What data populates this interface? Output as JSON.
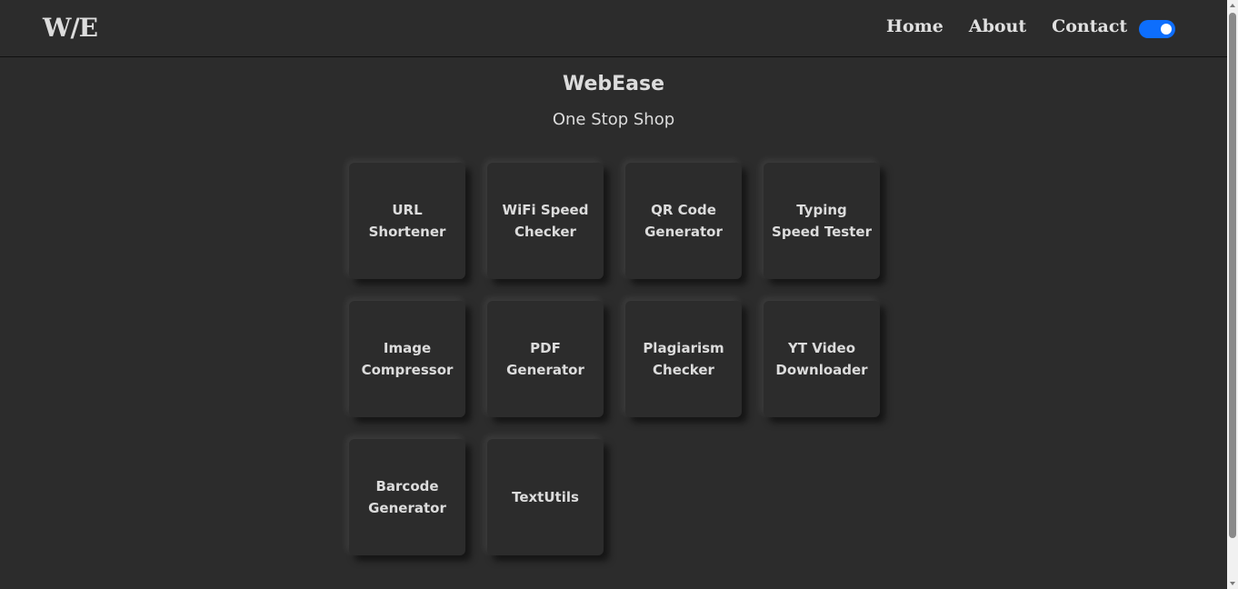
{
  "navbar": {
    "brand": "W/E",
    "links": [
      "Home",
      "About",
      "Contact"
    ],
    "dark_mode_toggle": {
      "on": true,
      "color": "#0d6efd"
    }
  },
  "hero": {
    "title": "WebEase",
    "subtitle": "One Stop Shop"
  },
  "tools": [
    "URL Shortener",
    "WiFi Speed Checker",
    "QR Code Generator",
    "Typing Speed Tester",
    "Image Compressor",
    "PDF Generator",
    "Plagiarism Checker",
    "YT Video Downloader",
    "Barcode Generator",
    "TextUtils"
  ],
  "colors": {
    "background": "#2c2c2c",
    "text": "#dcdcdc",
    "accent": "#0d6efd"
  }
}
